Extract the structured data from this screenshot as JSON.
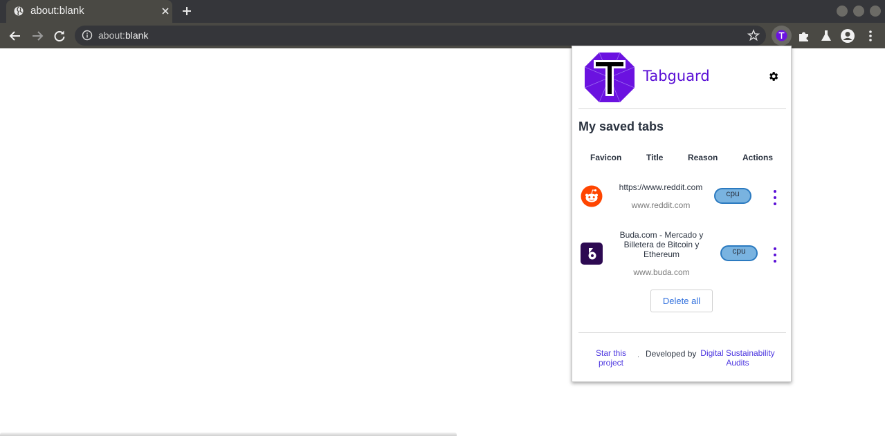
{
  "browser": {
    "tab_title": "about:blank",
    "url_prefix": "about:",
    "url_main": "blank"
  },
  "popup": {
    "brand_name": "Tabguard",
    "section_title": "My saved tabs",
    "columns": [
      "Favicon",
      "Title",
      "Reason",
      "Actions"
    ],
    "rows": [
      {
        "favicon": "reddit-icon",
        "title": "https://www.reddit.com",
        "domain": "www.reddit.com",
        "reason": "cpu"
      },
      {
        "favicon": "buda-icon",
        "title": "Buda.com - Mercado y Billetera de Bitcoin y Ethereum",
        "domain": "www.buda.com",
        "reason": "cpu"
      }
    ],
    "delete_all_label": "Delete all",
    "footer": {
      "star_link": "Star this project",
      "separator": "·",
      "developed_by": "Developed by",
      "dev_link": "Digital Sustainability Audits"
    }
  },
  "colors": {
    "brand": "#5a0fd6",
    "chrome_dark": "#35363a",
    "chrome_toolbar": "#4a4944",
    "pill_fill": "#79b3e0",
    "pill_border": "#2b7ac0",
    "link": "#4d37e0"
  }
}
